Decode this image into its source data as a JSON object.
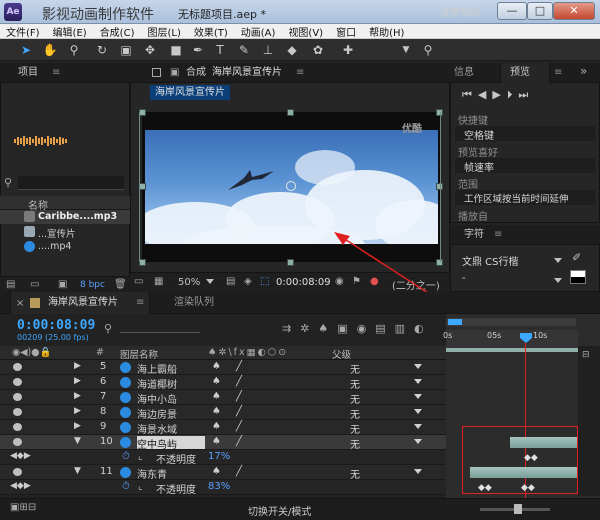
{
  "titlebar": {
    "app_name": "影视动画制作软件",
    "doc_title": "无标题项目.aep *",
    "minimize": "—",
    "maximize": "□",
    "close": "✕"
  },
  "menu": [
    "文件(F)",
    "编辑(E)",
    "合成(C)",
    "图层(L)",
    "效果(T)",
    "动画(A)",
    "视图(V)",
    "窗口",
    "帮助(H)"
  ],
  "toolbar": {
    "search_help": "搜索帮助"
  },
  "project": {
    "tab": "项目",
    "col_name": "名称",
    "items": [
      {
        "name": "Caribbe....mp3",
        "icon": "audio-file-icon"
      },
      {
        "name": "...宣传片",
        "icon": "composition-icon"
      },
      {
        "name": "....mp4",
        "icon": "video-file-icon"
      }
    ],
    "bpc": "8 bpc"
  },
  "composition": {
    "tab_prefix": "合成",
    "tab_name": "海岸风景宣传片",
    "breadcrumb": "海岸风景宣传片",
    "watermark": "优酷",
    "zoom": "50%",
    "timecode": "0:00:08:09",
    "resolution": "(二分之一)"
  },
  "right": {
    "tab_info": "信息",
    "tab_preview": "预览",
    "shortcut_label": "快捷键",
    "shortcut_value": "空格键",
    "preset_label": "预览喜好",
    "preset_value": "帧速率",
    "range_label": "范围",
    "range_value": "工作区域按当前时间延伸",
    "play_from_label": "播放自"
  },
  "character": {
    "tab": "字符",
    "font": "文鼎 CS行楷",
    "style": "-"
  },
  "timeline": {
    "tab_comp": "海岸风景宣传片",
    "tab_render": "渲染队列",
    "timecode": "0:00:08:09",
    "fps": "00209 (25.00 fps)",
    "col_layer_name": "图层名称",
    "col_parent": "父级",
    "ruler": [
      "0s",
      "05s",
      "10s"
    ],
    "layers": [
      {
        "num": "5",
        "name": "海上霸船",
        "parent": "无",
        "selected": false
      },
      {
        "num": "6",
        "name": "海道椰树",
        "parent": "无",
        "selected": false
      },
      {
        "num": "7",
        "name": "海中小岛",
        "parent": "无",
        "selected": false
      },
      {
        "num": "8",
        "name": "海边房景",
        "parent": "无",
        "selected": false
      },
      {
        "num": "9",
        "name": "海景水域",
        "parent": "无",
        "selected": false
      },
      {
        "num": "10",
        "name": "空中鸟屿",
        "parent": "无",
        "selected": true
      },
      {
        "num": "11",
        "name": "海东青",
        "parent": "无",
        "selected": false
      }
    ],
    "opacity_label": "不透明度",
    "opacity_10": "17%",
    "opacity_11": "83%",
    "footer": "切换开关/模式"
  },
  "colors": {
    "accent": "#3da8ff",
    "annotation": "#e02020",
    "layer_bar": "#8fb0a8"
  }
}
